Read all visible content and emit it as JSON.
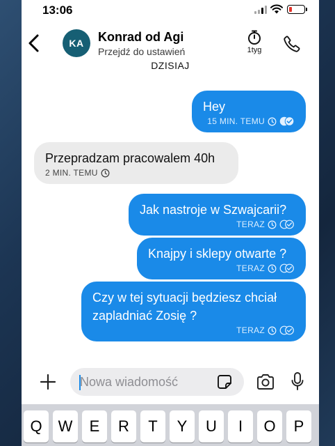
{
  "status_bar": {
    "time": "13:06"
  },
  "header": {
    "avatar_initials": "KA",
    "contact_name": "Konrad od Agi",
    "subtitle": "Przejdź do ustawień",
    "timer_label": "1tyg",
    "icons": [
      "chevron-left-icon",
      "stopwatch-icon",
      "phone-icon"
    ]
  },
  "conversation": {
    "day_label": "DZISIAJ",
    "messages": [
      {
        "direction": "outgoing",
        "text": "Hey",
        "time": "15 MIN. TEMU",
        "status": "read"
      },
      {
        "direction": "incoming",
        "text": "Przepradzam pracowalem 40h",
        "time": "2 MIN. TEMU"
      },
      {
        "direction": "outgoing",
        "text": "Jak nastroje w Szwajcarii?",
        "time": "TERAZ",
        "status": "delivered"
      },
      {
        "direction": "outgoing",
        "text": "Knajpy i sklepy otwarte ?",
        "time": "TERAZ",
        "status": "delivered"
      },
      {
        "direction": "outgoing",
        "text": "Czy w tej sytuacji będziesz chciał\nzapladniać Zosię ?",
        "time": "TERAZ",
        "status": "delivered"
      }
    ]
  },
  "compose": {
    "placeholder": "Nowa wiadomość",
    "value": "",
    "icons": [
      "plus-icon",
      "sticker-icon",
      "camera-icon",
      "microphone-icon"
    ]
  },
  "keyboard": {
    "row1": [
      "Q",
      "W",
      "E",
      "R",
      "T",
      "Y",
      "U",
      "I",
      "O",
      "P"
    ]
  },
  "colors": {
    "outgoing_bubble": "#1a8ae8",
    "incoming_bubble": "#ebebeb",
    "avatar": "#165f74",
    "battery_low": "#e5352b"
  }
}
